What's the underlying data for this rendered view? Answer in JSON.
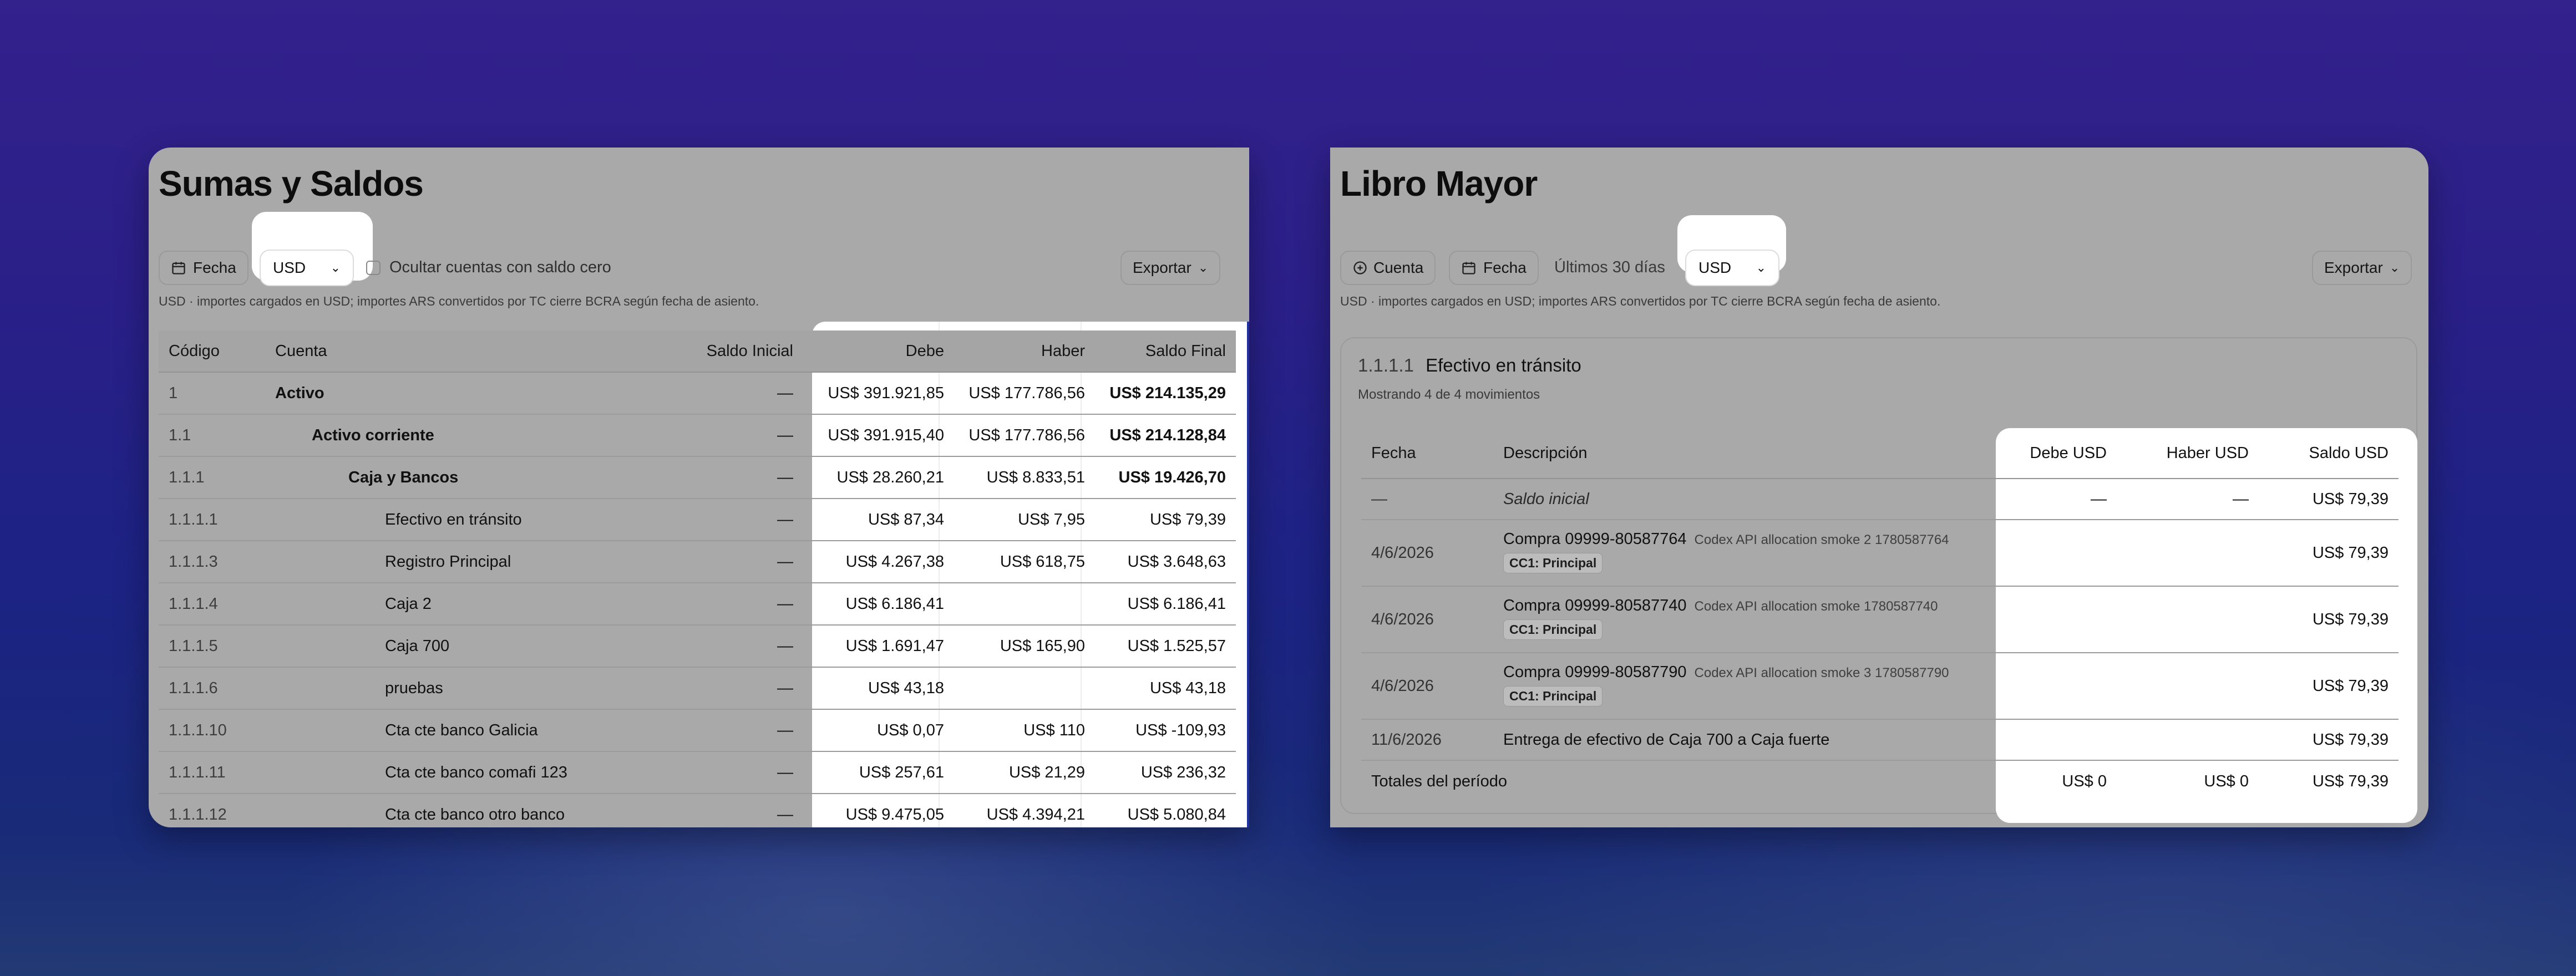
{
  "left": {
    "title": "Sumas y Saldos",
    "date_button": "Fecha",
    "currency": "USD",
    "hide_zero_label": "Ocultar cuentas con saldo cero",
    "export_label": "Exportar",
    "note": "USD · importes cargados en USD; importes ARS convertidos por TC cierre BCRA según fecha de asiento.",
    "columns": [
      "Código",
      "Cuenta",
      "Saldo Inicial",
      "Debe",
      "Haber",
      "Saldo Final"
    ],
    "rows": [
      {
        "code": "1",
        "account": "Activo",
        "level": 0,
        "bold": true,
        "initial": "—",
        "debe": "US$ 391.921,85",
        "haber": "US$ 177.786,56",
        "final": "US$ 214.135,29"
      },
      {
        "code": "1.1",
        "account": "Activo corriente",
        "level": 1,
        "bold": true,
        "initial": "—",
        "debe": "US$ 391.915,40",
        "haber": "US$ 177.786,56",
        "final": "US$ 214.128,84"
      },
      {
        "code": "1.1.1",
        "account": "Caja y Bancos",
        "level": 2,
        "bold": true,
        "initial": "—",
        "debe": "US$ 28.260,21",
        "haber": "US$ 8.833,51",
        "final": "US$ 19.426,70"
      },
      {
        "code": "1.1.1.1",
        "account": "Efectivo en tránsito",
        "level": 3,
        "bold": false,
        "initial": "—",
        "debe": "US$ 87,34",
        "haber": "US$ 7,95",
        "final": "US$ 79,39"
      },
      {
        "code": "1.1.1.3",
        "account": "Registro Principal",
        "level": 3,
        "bold": false,
        "initial": "—",
        "debe": "US$ 4.267,38",
        "haber": "US$ 618,75",
        "final": "US$ 3.648,63"
      },
      {
        "code": "1.1.1.4",
        "account": "Caja 2",
        "level": 3,
        "bold": false,
        "initial": "—",
        "debe": "US$ 6.186,41",
        "haber": "",
        "final": "US$ 6.186,41"
      },
      {
        "code": "1.1.1.5",
        "account": "Caja 700",
        "level": 3,
        "bold": false,
        "initial": "—",
        "debe": "US$ 1.691,47",
        "haber": "US$ 165,90",
        "final": "US$ 1.525,57"
      },
      {
        "code": "1.1.1.6",
        "account": "pruebas",
        "level": 3,
        "bold": false,
        "initial": "—",
        "debe": "US$ 43,18",
        "haber": "",
        "final": "US$ 43,18"
      },
      {
        "code": "1.1.1.10",
        "account": "Cta cte banco Galicia",
        "level": 3,
        "bold": false,
        "initial": "—",
        "debe": "US$ 0,07",
        "haber": "US$ 110",
        "final": "US$ -109,93"
      },
      {
        "code": "1.1.1.11",
        "account": "Cta cte banco comafi 123",
        "level": 3,
        "bold": false,
        "initial": "—",
        "debe": "US$ 257,61",
        "haber": "US$ 21,29",
        "final": "US$ 236,32"
      },
      {
        "code": "1.1.1.12",
        "account": "Cta cte banco otro banco",
        "level": 3,
        "bold": false,
        "initial": "—",
        "debe": "US$ 9.475,05",
        "haber": "US$ 4.394,21",
        "final": "US$ 5.080,84"
      }
    ]
  },
  "right": {
    "title": "Libro Mayor",
    "account_button": "Cuenta",
    "date_button": "Fecha",
    "range_text": "Últimos 30 días",
    "currency": "USD",
    "export_label": "Exportar",
    "note": "USD · importes cargados en USD; importes ARS convertidos por TC cierre BCRA según fecha de asiento.",
    "account_code": "1.1.1.1",
    "account_name": "Efectivo en tránsito",
    "showing": "Mostrando 4 de 4 movimientos",
    "columns": [
      "Fecha",
      "Descripción",
      "Debe USD",
      "Haber USD",
      "Saldo USD"
    ],
    "opening": {
      "date": "—",
      "desc": "Saldo inicial",
      "debe": "—",
      "haber": "—",
      "saldo": "US$ 79,39"
    },
    "rows": [
      {
        "date": "4/6/2026",
        "desc": "Compra 09999-80587764",
        "meta": "Codex API allocation smoke 2 1780587764",
        "tag": "CC1: Principal",
        "saldo": "US$ 79,39"
      },
      {
        "date": "4/6/2026",
        "desc": "Compra 09999-80587740",
        "meta": "Codex API allocation smoke 1780587740",
        "tag": "CC1: Principal",
        "saldo": "US$ 79,39"
      },
      {
        "date": "4/6/2026",
        "desc": "Compra 09999-80587790",
        "meta": "Codex API allocation smoke 3 1780587790",
        "tag": "CC1: Principal",
        "saldo": "US$ 79,39"
      }
    ],
    "last_row": {
      "date": "11/6/2026",
      "desc": "Entrega de efectivo de Caja 700 a Caja fuerte",
      "saldo": "US$ 79,39"
    },
    "totals": {
      "label": "Totales del período",
      "debe": "US$ 0",
      "haber": "US$ 0",
      "saldo": "US$ 79,39"
    }
  }
}
